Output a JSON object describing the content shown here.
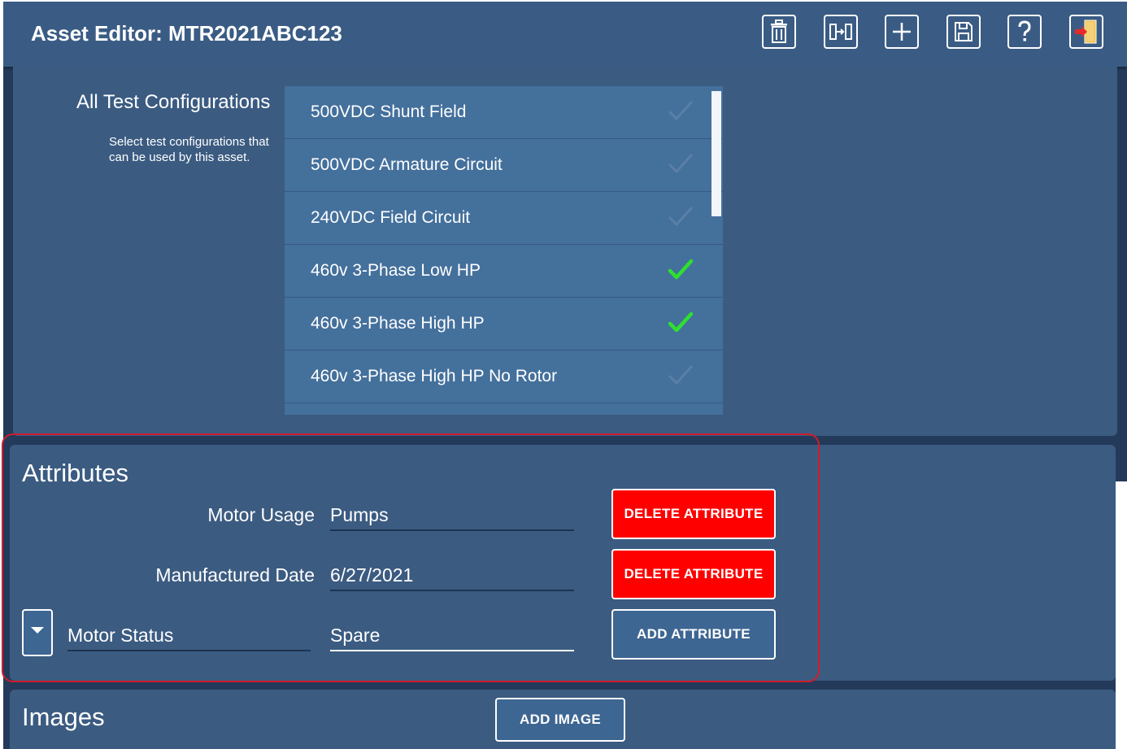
{
  "header": {
    "title": "Asset Editor:  MTR2021ABC123",
    "tools": [
      {
        "name": "delete-icon",
        "label": "Delete"
      },
      {
        "name": "swap-icon",
        "label": "Move"
      },
      {
        "name": "add-icon",
        "label": "Add"
      },
      {
        "name": "save-icon",
        "label": "Save"
      },
      {
        "name": "help-icon",
        "label": "Help"
      },
      {
        "name": "exit-icon",
        "label": "Exit"
      }
    ]
  },
  "configs": {
    "label": "All Test Configurations",
    "help": "Select test configurations that can be used by this asset.",
    "items": [
      {
        "name": "500VDC Shunt Field",
        "selected": false
      },
      {
        "name": "500VDC Armature Circuit",
        "selected": false
      },
      {
        "name": "240VDC Field Circuit",
        "selected": false
      },
      {
        "name": "460v 3-Phase Low HP",
        "selected": true
      },
      {
        "name": "460v 3-Phase High HP",
        "selected": true
      },
      {
        "name": "460v 3-Phase High HP No Rotor",
        "selected": false
      }
    ]
  },
  "attributes": {
    "title": "Attributes",
    "rows": [
      {
        "label": "Motor Usage",
        "value": "Pumps",
        "button": "DELETE ATTRIBUTE"
      },
      {
        "label": "Manufactured Date",
        "value": "6/27/2021",
        "button": "DELETE ATTRIBUTE"
      }
    ],
    "new_row": {
      "label": "Motor Status",
      "value": "Spare",
      "button": "ADD ATTRIBUTE"
    }
  },
  "images": {
    "title": "Images",
    "button": "ADD IMAGE"
  },
  "colors": {
    "panel": "#3b5b81",
    "header": "#3a5c84",
    "danger": "#ff0000",
    "check_selected": "#2ee02e",
    "highlight": "#d01c2c"
  }
}
